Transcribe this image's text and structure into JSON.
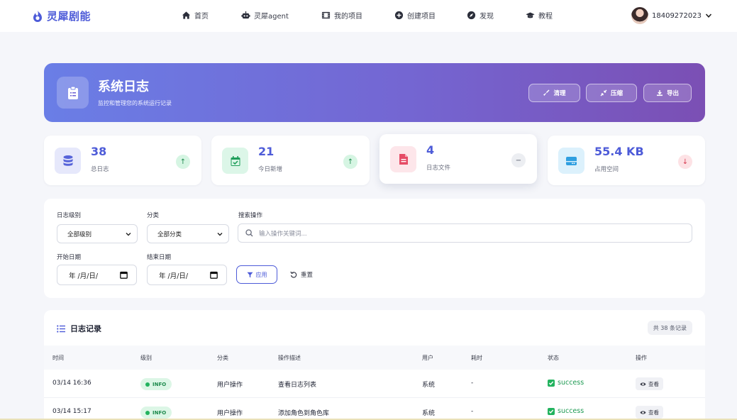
{
  "brand": {
    "name": "灵犀剧能"
  },
  "nav": [
    {
      "label": "首页",
      "icon": "home-icon"
    },
    {
      "label": "灵犀agent",
      "icon": "robot-icon"
    },
    {
      "label": "我的项目",
      "icon": "film-icon"
    },
    {
      "label": "创建项目",
      "icon": "plus-circle-icon"
    },
    {
      "label": "发现",
      "icon": "compass-icon"
    },
    {
      "label": "教程",
      "icon": "graduation-cap-icon"
    }
  ],
  "user": {
    "name": "18409272023"
  },
  "hero": {
    "title": "系统日志",
    "subtitle": "监控和管理您的系统运行记录",
    "buttons": {
      "clean": "清理",
      "compress": "压缩",
      "export": "导出"
    }
  },
  "stats": [
    {
      "value": "38",
      "label": "总日志",
      "trend": "up"
    },
    {
      "value": "21",
      "label": "今日新增",
      "trend": "up"
    },
    {
      "value": "4",
      "label": "日志文件",
      "trend": "flat"
    },
    {
      "value": "55.4 KB",
      "label": "占用空间",
      "trend": "down"
    }
  ],
  "filters": {
    "level_label": "日志级别",
    "level_value": "全部级别",
    "category_label": "分类",
    "category_value": "全部分类",
    "search_label": "搜索操作",
    "search_placeholder": "输入操作关键词...",
    "start_label": "开始日期",
    "start_value": "年 /月/日/",
    "end_label": "结束日期",
    "end_value": "年 /月/日/",
    "apply": "应用",
    "reset": "重置"
  },
  "records": {
    "title": "日志记录",
    "count": "共 38 条记录",
    "columns": [
      "时间",
      "级别",
      "分类",
      "操作描述",
      "用户",
      "耗时",
      "状态",
      "操作"
    ],
    "rows": [
      {
        "time": "03/14 16:36",
        "level": "INFO",
        "category": "用户操作",
        "desc": "查看日志列表",
        "user": "系统",
        "duration": "-",
        "status": "success",
        "action": "查看"
      },
      {
        "time": "03/14 15:17",
        "level": "INFO",
        "category": "用户操作",
        "desc": "添加角色到角色库",
        "user": "系统",
        "duration": "-",
        "status": "success",
        "action": "查看"
      }
    ]
  },
  "colors": {
    "accent": "#4d5bd8",
    "success": "#22b35e",
    "hero_start": "#6a7ee6",
    "hero_end": "#7b4fb4"
  }
}
